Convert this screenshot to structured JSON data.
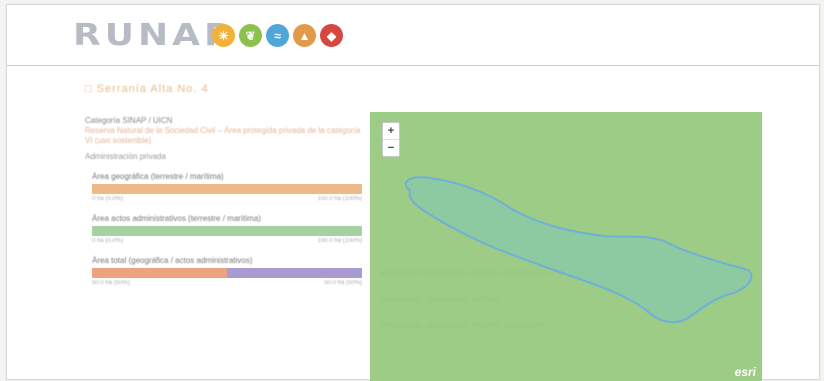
{
  "logo": {
    "text": "RUNAP",
    "icons": [
      {
        "name": "sun-icon",
        "color": "#f2b23a",
        "glyph": "☀"
      },
      {
        "name": "leaf-icon",
        "color": "#8cc14d",
        "glyph": "❦"
      },
      {
        "name": "water-icon",
        "color": "#4fa6d8",
        "glyph": "≈"
      },
      {
        "name": "mountain-icon",
        "color": "#e29a4a",
        "glyph": "▲"
      },
      {
        "name": "animal-icon",
        "color": "#d6473f",
        "glyph": "◆"
      }
    ]
  },
  "area_title": "□ Serranía Alta No. 4",
  "info": {
    "category_label": "Categoría SINAP / UICN",
    "category_value": "Reserva Natural de la Sociedad Civil – Área protegida privada de la categoría VI (uso sostenible)",
    "admin": "Administración privada"
  },
  "metrics": [
    {
      "title": "Área geográfica (terrestre / marítima)",
      "segments": [
        {
          "color": "#f0b98a",
          "fraction": 1.0
        }
      ],
      "scale_left": "0 ha  (0.0%)",
      "scale_right": "100.0 ha (100%)"
    },
    {
      "title": "Área actos administrativos (terrestre / marítima)",
      "segments": [
        {
          "color": "#a6d2a2",
          "fraction": 1.0
        }
      ],
      "scale_left": "0 ha  (0.0%)",
      "scale_right": "100.0 ha (100%)"
    },
    {
      "title": "Área total (geográfica / actos administrativos)",
      "segments": [
        {
          "color": "#eca47e",
          "fraction": 0.5
        },
        {
          "color": "#a99ad0",
          "fraction": 0.5
        }
      ],
      "scale_left": "50.0 ha (50%)",
      "scale_right": "50.0 ha (50%)"
    }
  ],
  "map": {
    "zoom_in": "+",
    "zoom_out": "−",
    "attribution": "esri",
    "background": "#9ccc85",
    "polygon_fill": "#8cc9a6",
    "polygon_stroke": "#6fb0d8"
  },
  "bleed_text": [
    "……… ……… …… ……… …",
    "……… ……… ……",
    "……… ……… …… ………"
  ]
}
